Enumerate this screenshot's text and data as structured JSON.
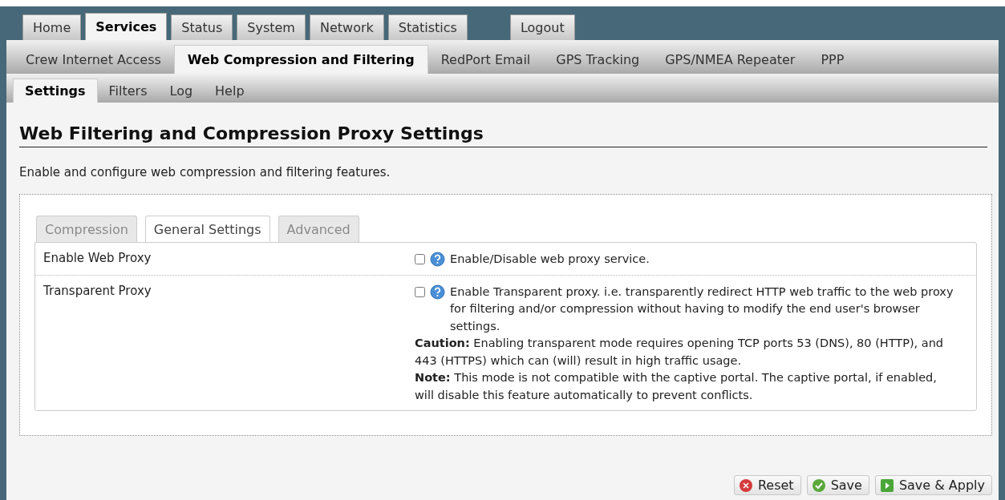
{
  "main_tabs": [
    {
      "label": "Home",
      "selected": false
    },
    {
      "label": "Services",
      "selected": true
    },
    {
      "label": "Status",
      "selected": false
    },
    {
      "label": "System",
      "selected": false
    },
    {
      "label": "Network",
      "selected": false
    },
    {
      "label": "Statistics",
      "selected": false
    },
    {
      "label": "Logout",
      "selected": false,
      "kind": "separate"
    }
  ],
  "service_tabs": [
    {
      "label": "Crew Internet Access",
      "selected": false
    },
    {
      "label": "Web Compression and Filtering",
      "selected": true
    },
    {
      "label": "RedPort Email",
      "selected": false
    },
    {
      "label": "GPS Tracking",
      "selected": false
    },
    {
      "label": "GPS/NMEA Repeater",
      "selected": false
    },
    {
      "label": "PPP",
      "selected": false
    }
  ],
  "page_tabs": [
    {
      "label": "Settings",
      "selected": true
    },
    {
      "label": "Filters",
      "selected": false
    },
    {
      "label": "Log",
      "selected": false
    },
    {
      "label": "Help",
      "selected": false
    }
  ],
  "title": "Web Filtering and Compression Proxy Settings",
  "description": "Enable and configure web compression and filtering features.",
  "section_tabs": [
    {
      "label": "Compression",
      "selected": false,
      "disabled": true
    },
    {
      "label": "General Settings",
      "selected": true,
      "disabled": false
    },
    {
      "label": "Advanced",
      "selected": false,
      "disabled": true
    }
  ],
  "settings": [
    {
      "label": "Enable Web Proxy",
      "checked": false,
      "text": [
        "Enable/Disable web proxy service."
      ]
    },
    {
      "label": "Transparent Proxy",
      "checked": false,
      "text": [
        "Enable Transparent proxy. i.e. transparently redirect HTTP web traffic to the web proxy for filtering and/or compression without having to modify the end user's browser settings.",
        "**Caution:** Enabling transparent mode requires opening TCP ports 53 (DNS), 80 (HTTP), and 443 (HTTPS) which can (will) result in high traffic usage.",
        "**Note:** This mode is not compatible with the captive portal. The captive portal, if enabled, will disable this feature automatically to prevent conflicts."
      ]
    }
  ],
  "buttons": [
    {
      "label": "Reset",
      "kind": "reset"
    },
    {
      "label": "Save",
      "kind": "save"
    },
    {
      "label": "Save & Apply",
      "kind": "apply"
    }
  ]
}
